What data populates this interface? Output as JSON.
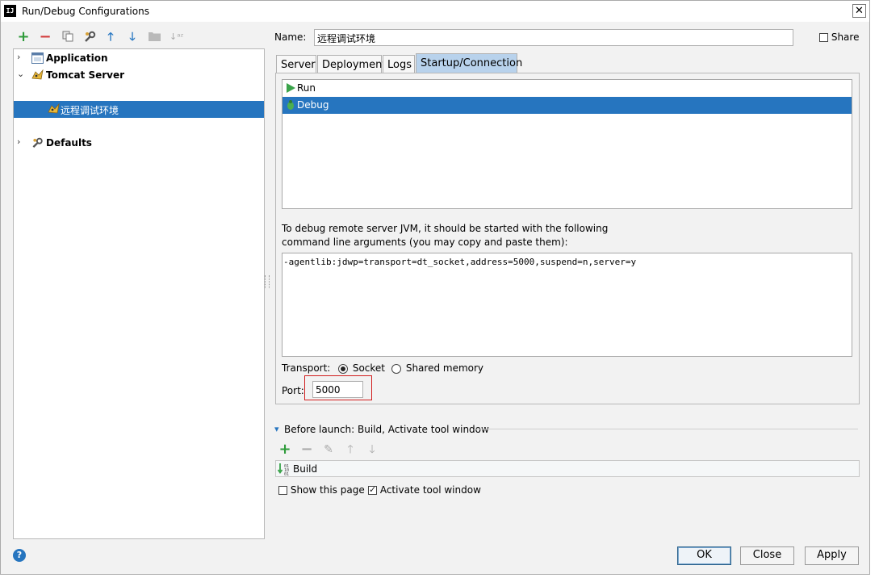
{
  "window": {
    "title": "Run/Debug Configurations",
    "logo": "IJ"
  },
  "toolbar": {
    "icons": [
      "add-icon",
      "remove-icon",
      "copy-icon",
      "wrench-icon",
      "arrow-up-icon",
      "arrow-down-icon",
      "folder-icon",
      "sort-icon"
    ]
  },
  "tree": {
    "items": [
      {
        "label": "Application",
        "icon": "application-icon",
        "expander": "›"
      },
      {
        "label": "Tomcat Server",
        "icon": "tomcat-icon",
        "expander": "⌄"
      },
      {
        "label": "远程调试环境",
        "icon": "tomcat-icon"
      },
      {
        "label": "Defaults",
        "icon": "wrench-icon",
        "expander": "›"
      }
    ]
  },
  "form": {
    "name_label": "Name:",
    "name_value": "远程调试环境",
    "share_label": "Share"
  },
  "tabs": [
    "Server",
    "Deployment",
    "Logs",
    "Startup/Connection"
  ],
  "startup": {
    "modes": [
      "Run",
      "Debug"
    ],
    "info_line1": "To debug remote server JVM, it should be started with the following",
    "info_line2": "command line arguments (you may copy and paste them):",
    "args": "-agentlib:jdwp=transport=dt_socket,address=5000,suspend=n,server=y",
    "transport_label": "Transport:",
    "transport_socket": "Socket",
    "transport_shared": "Shared memory",
    "port_label": "Port:",
    "port_value": "5000"
  },
  "before_launch": {
    "title": "Before launch: Build, Activate tool window",
    "task": "Build",
    "show_page": "Show this page",
    "activate": "Activate tool window"
  },
  "buttons": {
    "ok": "OK",
    "close": "Close",
    "apply": "Apply"
  },
  "colors": {
    "selection": "#2675bf",
    "active_tab": "#b8d2ec",
    "highlight_border": "#d11d1d"
  }
}
